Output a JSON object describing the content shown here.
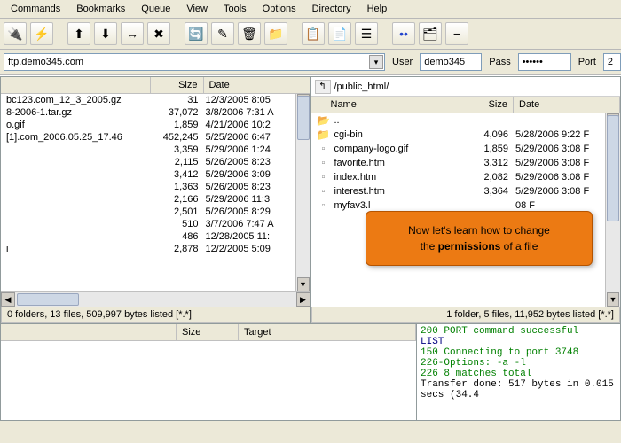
{
  "menu": [
    "Commands",
    "Bookmarks",
    "Queue",
    "View",
    "Tools",
    "Options",
    "Directory",
    "Help"
  ],
  "conn": {
    "host": "ftp.demo345.com",
    "user_label": "User",
    "user": "demo345",
    "pass_label": "Pass",
    "pass": "******",
    "port_label": "Port",
    "port": "2"
  },
  "left": {
    "head": {
      "name": "",
      "size": "Size",
      "date": "Date"
    },
    "rows": [
      {
        "name": "bc123.com_12_3_2005.gz",
        "size": "31",
        "date": "12/3/2005 8:05"
      },
      {
        "name": "8-2006-1.tar.gz",
        "size": "37,072",
        "date": "3/8/2006 7:31 A"
      },
      {
        "name": "o.gif",
        "size": "1,859",
        "date": "4/21/2006 10:2"
      },
      {
        "name": "[1].com_2006.05.25_17.46",
        "size": "452,245",
        "date": "5/25/2006 6:47"
      },
      {
        "name": "",
        "size": "3,359",
        "date": "5/29/2006 1:24"
      },
      {
        "name": "",
        "size": "2,115",
        "date": "5/26/2005 8:23"
      },
      {
        "name": "",
        "size": "3,412",
        "date": "5/29/2006 3:09"
      },
      {
        "name": "",
        "size": "1,363",
        "date": "5/26/2005 8:23"
      },
      {
        "name": "",
        "size": "2,166",
        "date": "5/29/2006 11:3"
      },
      {
        "name": "",
        "size": "2,501",
        "date": "5/26/2005 8:29"
      },
      {
        "name": "",
        "size": "510",
        "date": "3/7/2006 7:47 A"
      },
      {
        "name": "",
        "size": "486",
        "date": "12/28/2005 11:"
      },
      {
        "name": "i",
        "size": "2,878",
        "date": "12/2/2005 5:09"
      }
    ],
    "status": "0 folders, 13 files, 509,997 bytes listed [*.*]"
  },
  "right": {
    "path": "/public_html/",
    "head": {
      "name": "Name",
      "size": "Size",
      "date": "Date"
    },
    "rows": [
      {
        "icon": "up",
        "name": "..",
        "size": "",
        "date": ""
      },
      {
        "icon": "folder",
        "name": "cgi-bin",
        "size": "4,096",
        "date": "5/28/2006 9:22 F"
      },
      {
        "icon": "file",
        "name": "company-logo.gif",
        "size": "1,859",
        "date": "5/29/2006 3:08 F"
      },
      {
        "icon": "file",
        "name": "favorite.htm",
        "size": "3,312",
        "date": "5/29/2006 3:08 F"
      },
      {
        "icon": "file",
        "name": "index.htm",
        "size": "2,082",
        "date": "5/29/2006 3:08 F"
      },
      {
        "icon": "file",
        "name": "interest.htm",
        "size": "3,364",
        "date": "5/29/2006 3:08 F"
      },
      {
        "icon": "file",
        "name": "myfav3.l",
        "size": "",
        "date": "08 F"
      }
    ],
    "status": "1 folder, 5 files, 11,952 bytes listed [*.*]"
  },
  "queue_head": {
    "size": "Size",
    "target": "Target"
  },
  "log": [
    {
      "cls": "ok",
      "t": "200 PORT command successful"
    },
    {
      "cls": "info",
      "t": "LIST"
    },
    {
      "cls": "ok",
      "t": "150 Connecting to port 3748"
    },
    {
      "cls": "ok",
      "t": "226-Options: -a -l"
    },
    {
      "cls": "ok",
      "t": "226 8 matches total"
    },
    {
      "cls": "",
      "t": "Transfer done: 517 bytes in 0.015 secs (34.4"
    }
  ],
  "callout": {
    "line1": "Now let's learn how to change",
    "line2a": "the ",
    "bold": "permissions",
    "line2b": " of a file"
  }
}
